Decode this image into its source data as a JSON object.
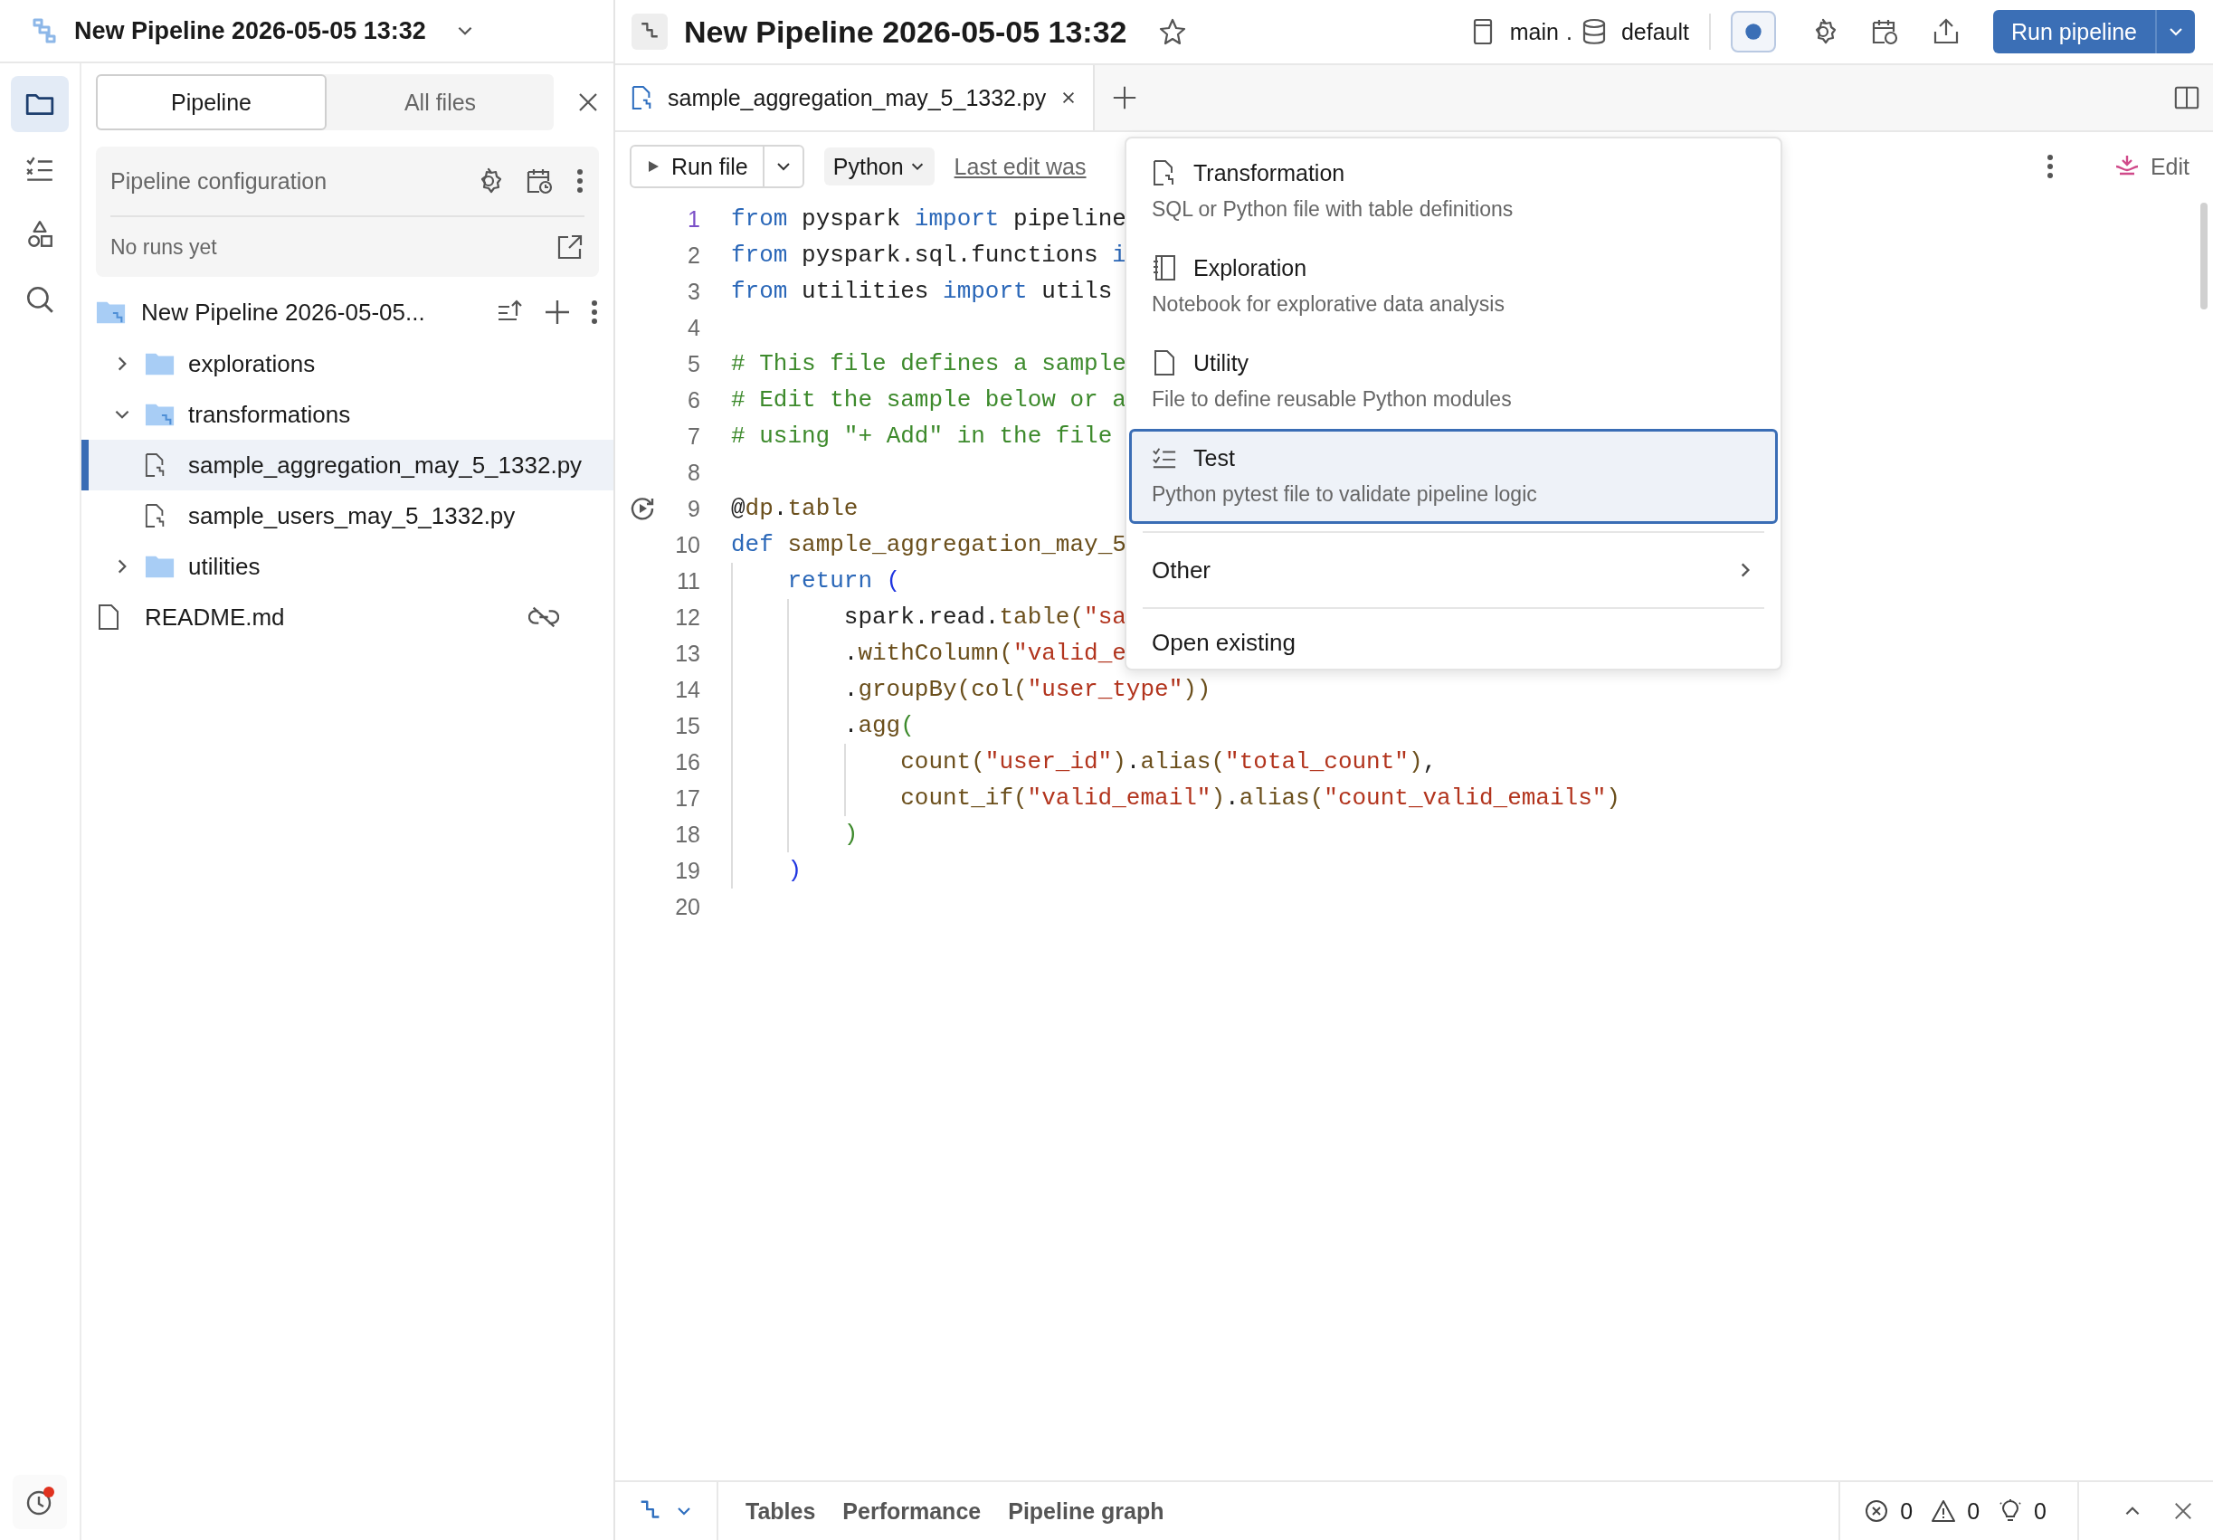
{
  "left_header": {
    "title": "New Pipeline 2026-05-05 13:32"
  },
  "rail": [
    {
      "kind": "folder",
      "selected": true
    },
    {
      "kind": "checklist",
      "selected": false
    },
    {
      "kind": "shapes",
      "selected": false
    },
    {
      "kind": "search",
      "selected": false
    }
  ],
  "rail_footer": {
    "notification": true
  },
  "sidebar": {
    "tabs": [
      {
        "label": "Pipeline",
        "selected": true
      },
      {
        "label": "All files",
        "selected": false
      }
    ],
    "config": {
      "title": "Pipeline configuration",
      "status": "No runs yet"
    },
    "tree": {
      "label": "New Pipeline 2026-05-05...",
      "children": [
        {
          "label": "explorations",
          "kind": "folder",
          "expanded": false,
          "selected": false,
          "excluded": false
        },
        {
          "label": "transformations",
          "kind": "pipeline-folder",
          "expanded": true,
          "selected": false,
          "excluded": false,
          "children": [
            {
              "label": "sample_aggregation_may_5_1332.py",
              "kind": "pipeline-file",
              "selected": true,
              "excluded": false
            },
            {
              "label": "sample_users_may_5_1332.py",
              "kind": "pipeline-file",
              "selected": false,
              "excluded": false
            }
          ]
        },
        {
          "label": "utilities",
          "kind": "folder",
          "expanded": false,
          "selected": false,
          "excluded": false
        },
        {
          "label": "README.md",
          "kind": "file",
          "selected": false,
          "excluded": true
        }
      ]
    }
  },
  "header": {
    "title": "New Pipeline 2026-05-05 13:32",
    "starred": false,
    "branch": "main",
    "separator": ".",
    "schema": "default",
    "toggle_on": true,
    "run_button": "Run pipeline"
  },
  "editor_tabs": [
    {
      "label": "sample_aggregation_may_5_1332.py",
      "selected": true
    }
  ],
  "toolbar": {
    "run_file": "Run file",
    "language": "Python",
    "last_edit": "Last edit was",
    "edit": "Edit"
  },
  "code": [
    {
      "number": "1",
      "active": true,
      "tokens": [
        {
          "text": "from",
          "kind": "keyword"
        },
        {
          "text": " pyspark ",
          "kind": "plain"
        },
        {
          "text": "import",
          "kind": "keyword"
        },
        {
          "text": " pipeline",
          "kind": "plain"
        }
      ]
    },
    {
      "number": "2",
      "active": false,
      "tokens": [
        {
          "text": "from",
          "kind": "keyword"
        },
        {
          "text": " pyspark.sql.functions ",
          "kind": "plain"
        },
        {
          "text": "i",
          "kind": "keyword"
        }
      ]
    },
    {
      "number": "3",
      "active": false,
      "tokens": [
        {
          "text": "from",
          "kind": "keyword"
        },
        {
          "text": " utilities ",
          "kind": "plain"
        },
        {
          "text": "import",
          "kind": "keyword"
        },
        {
          "text": " utils",
          "kind": "plain"
        }
      ]
    },
    {
      "number": "4",
      "active": false
    },
    {
      "number": "5",
      "active": false,
      "tokens": [
        {
          "text": "# This file defines a sample",
          "kind": "comment"
        }
      ]
    },
    {
      "number": "6",
      "active": false,
      "tokens": [
        {
          "text": "# Edit the sample below or a",
          "kind": "comment"
        }
      ]
    },
    {
      "number": "7",
      "active": false,
      "tokens": [
        {
          "text": "# using \"+ Add\" in the file",
          "kind": "comment"
        }
      ]
    },
    {
      "number": "8",
      "active": false
    },
    {
      "number": "9",
      "active": false,
      "run_marker": true,
      "tokens": [
        {
          "text": "@",
          "kind": "plain"
        },
        {
          "text": "dp",
          "kind": "function"
        },
        {
          "text": ".",
          "kind": "plain"
        },
        {
          "text": "table",
          "kind": "function"
        }
      ]
    },
    {
      "number": "10",
      "active": false,
      "tokens": [
        {
          "text": "def ",
          "kind": "keyword"
        },
        {
          "text": "sample_aggregation_may_5",
          "kind": "function"
        }
      ],
      "children": [
        {
          "number": "11",
          "active": false,
          "tokens": [
            {
              "text": "return ",
              "kind": "keyword"
            },
            {
              "text": "(",
              "kind": "bracket-outer"
            }
          ],
          "children": [
            {
              "number": "12",
              "active": false,
              "tokens": [
                {
                  "text": "spark.read.",
                  "kind": "plain"
                },
                {
                  "text": "table(",
                  "kind": "function"
                },
                {
                  "text": "\"sa",
                  "kind": "string"
                }
              ]
            },
            {
              "number": "13",
              "active": false,
              "tokens": [
                {
                  "text": ".",
                  "kind": "plain"
                },
                {
                  "text": "withColumn(",
                  "kind": "function"
                },
                {
                  "text": "\"valid_e",
                  "kind": "string"
                }
              ]
            },
            {
              "number": "14",
              "active": false,
              "tokens": [
                {
                  "text": ".",
                  "kind": "plain"
                },
                {
                  "text": "groupBy(col(",
                  "kind": "function"
                },
                {
                  "text": "\"user_type\"",
                  "kind": "string"
                },
                {
                  "text": "))",
                  "kind": "function"
                }
              ]
            },
            {
              "number": "15",
              "active": false,
              "tokens": [
                {
                  "text": ".",
                  "kind": "plain"
                },
                {
                  "text": "agg",
                  "kind": "function"
                },
                {
                  "text": "(",
                  "kind": "bracket-inner"
                }
              ],
              "children": [
                {
                  "number": "16",
                  "active": false,
                  "tokens": [
                    {
                      "text": "count(",
                      "kind": "function"
                    },
                    {
                      "text": "\"user_id\"",
                      "kind": "string"
                    },
                    {
                      "text": ")",
                      "kind": "function"
                    },
                    {
                      "text": ".",
                      "kind": "plain"
                    },
                    {
                      "text": "alias(",
                      "kind": "function"
                    },
                    {
                      "text": "\"total_count\"",
                      "kind": "string"
                    },
                    {
                      "text": ")",
                      "kind": "function"
                    },
                    {
                      "text": ",",
                      "kind": "plain"
                    }
                  ]
                },
                {
                  "number": "17",
                  "active": false,
                  "tokens": [
                    {
                      "text": "count_if(",
                      "kind": "function"
                    },
                    {
                      "text": "\"valid_email\"",
                      "kind": "string"
                    },
                    {
                      "text": ")",
                      "kind": "function"
                    },
                    {
                      "text": ".",
                      "kind": "plain"
                    },
                    {
                      "text": "alias(",
                      "kind": "function"
                    },
                    {
                      "text": "\"count_valid_emails\"",
                      "kind": "string"
                    },
                    {
                      "text": ")",
                      "kind": "function"
                    }
                  ]
                }
              ]
            },
            {
              "number": "18",
              "active": false,
              "tokens": [
                {
                  "text": ")",
                  "kind": "bracket-inner"
                }
              ]
            }
          ]
        },
        {
          "number": "19",
          "active": false,
          "tokens": [
            {
              "text": ")",
              "kind": "bracket-outer"
            }
          ]
        }
      ]
    },
    {
      "number": "20",
      "active": false
    }
  ],
  "new_file_menu": {
    "items": [
      {
        "kind": "transformation",
        "title": "Transformation",
        "description": "SQL or Python file with table definitions",
        "selected": false
      },
      {
        "kind": "exploration",
        "title": "Exploration",
        "description": "Notebook for explorative data analysis",
        "selected": false
      },
      {
        "kind": "utility",
        "title": "Utility",
        "description": "File to define reusable Python modules",
        "selected": false
      },
      {
        "kind": "test",
        "title": "Test",
        "description": "Python pytest file to validate pipeline logic",
        "selected": true
      }
    ],
    "submenu": "Other",
    "open_existing": "Open existing"
  },
  "bottom_bar": {
    "tabs": [
      "Tables",
      "Performance",
      "Pipeline graph"
    ],
    "errors": "0",
    "warnings": "0",
    "hints": "0"
  }
}
